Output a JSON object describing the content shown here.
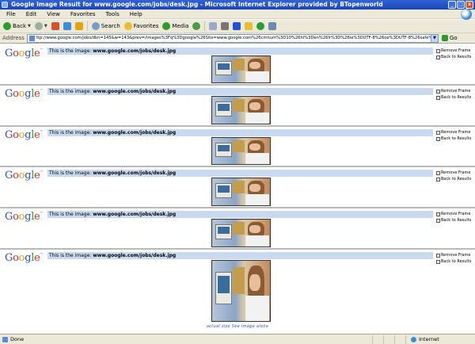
{
  "window": {
    "title": "Google Image Result for www.google.com/jobs/desk.jpg - Microsoft Internet Explorer provided by BTopenworld",
    "buttons": [
      "_",
      "□",
      "x"
    ]
  },
  "menu": [
    "File",
    "Edit",
    "View",
    "Favorites",
    "Tools",
    "Help"
  ],
  "toolbar": {
    "back": "Back",
    "search": "Search",
    "favorites": "Favorites",
    "media": "Media"
  },
  "address": {
    "label": "Address",
    "url": "ttp://www.google.com/jobs/dkn=145&w=143&prev=/images%3Fq%3Dgoogle%26Site=www.google.com%26cmnum%3D10%26hl%3Den%26lr%3D%26ie%3DUTF-8%26oe%3DUTF-8%26safe%3Doff",
    "go": "Go"
  },
  "page": {
    "logo": "Google",
    "logo_tm": "™",
    "image_prefix": "This is the image: ",
    "image_url": "www.google.com/jobs/desk.jpg",
    "remove_frame": "Remove Frame",
    "back_to_results": "Back to Results",
    "caption": "actual size   See image alone"
  },
  "status": {
    "text": "Done",
    "zone": "Internet"
  }
}
